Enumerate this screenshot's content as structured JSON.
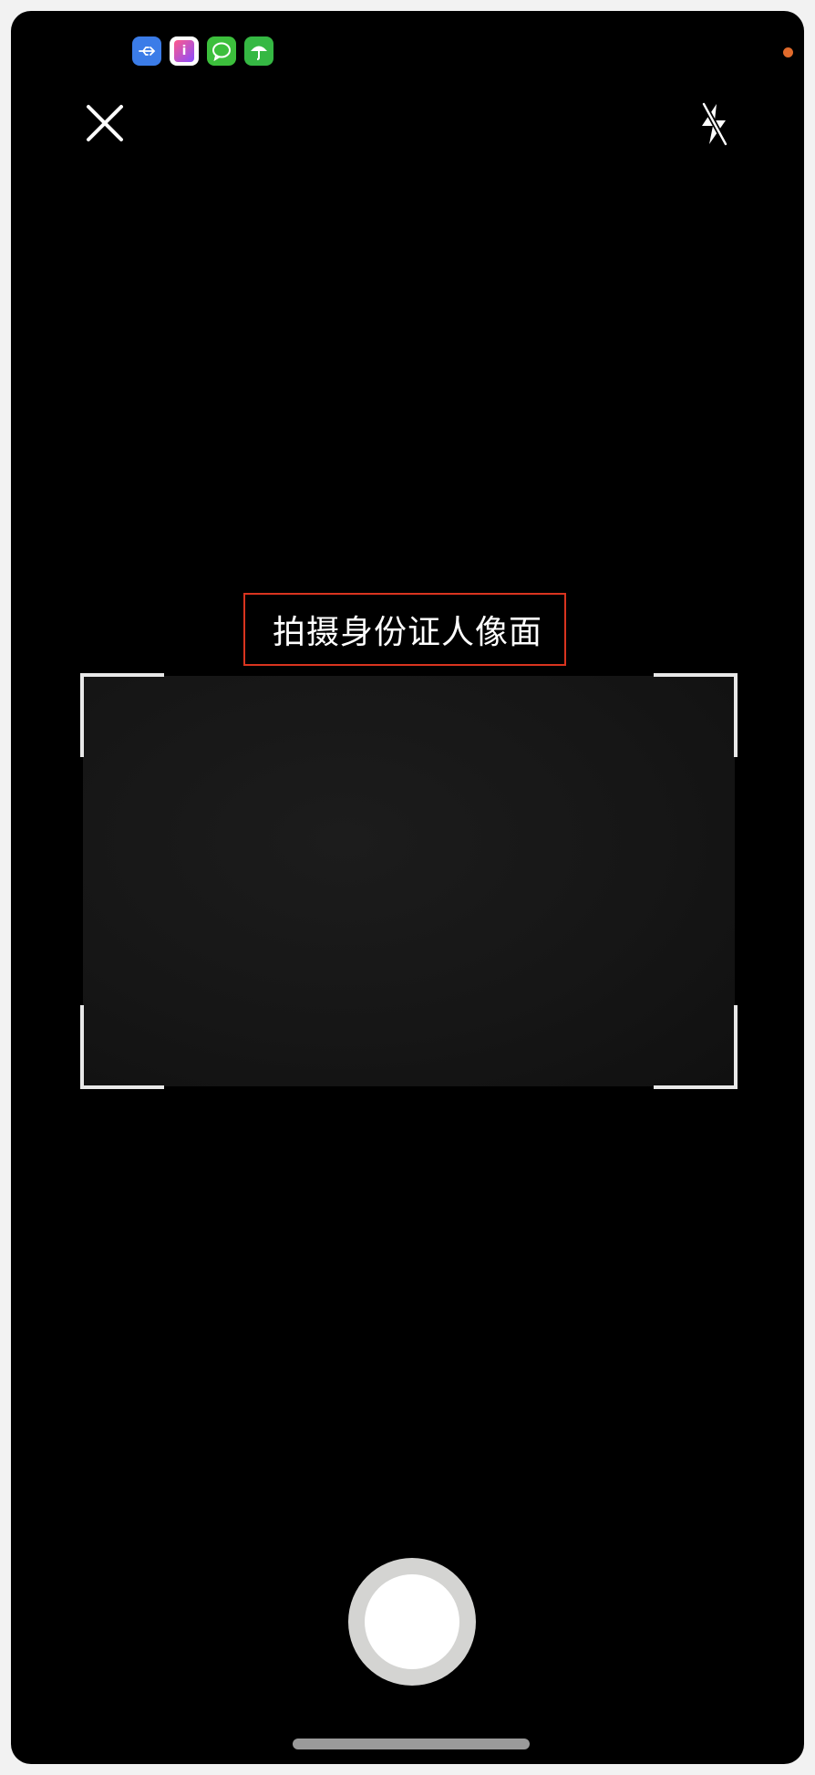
{
  "status_bar": {
    "icons": [
      {
        "name": "usb-icon",
        "glyph": "⇆",
        "color": "#3b7ce8"
      },
      {
        "name": "book-app-icon",
        "glyph": "i",
        "color": "#e8447a"
      },
      {
        "name": "message-app-icon",
        "glyph": "◯",
        "color": "#3cbf3c"
      },
      {
        "name": "umbrella-app-icon",
        "glyph": "☂",
        "color": "#35b843"
      }
    ],
    "notification_dot_color": "#e06a2b"
  },
  "camera": {
    "prompt": "拍摄身份证人像面",
    "prompt_border_color": "#d9341f",
    "frame_corner_color": "#e8e8e8"
  }
}
